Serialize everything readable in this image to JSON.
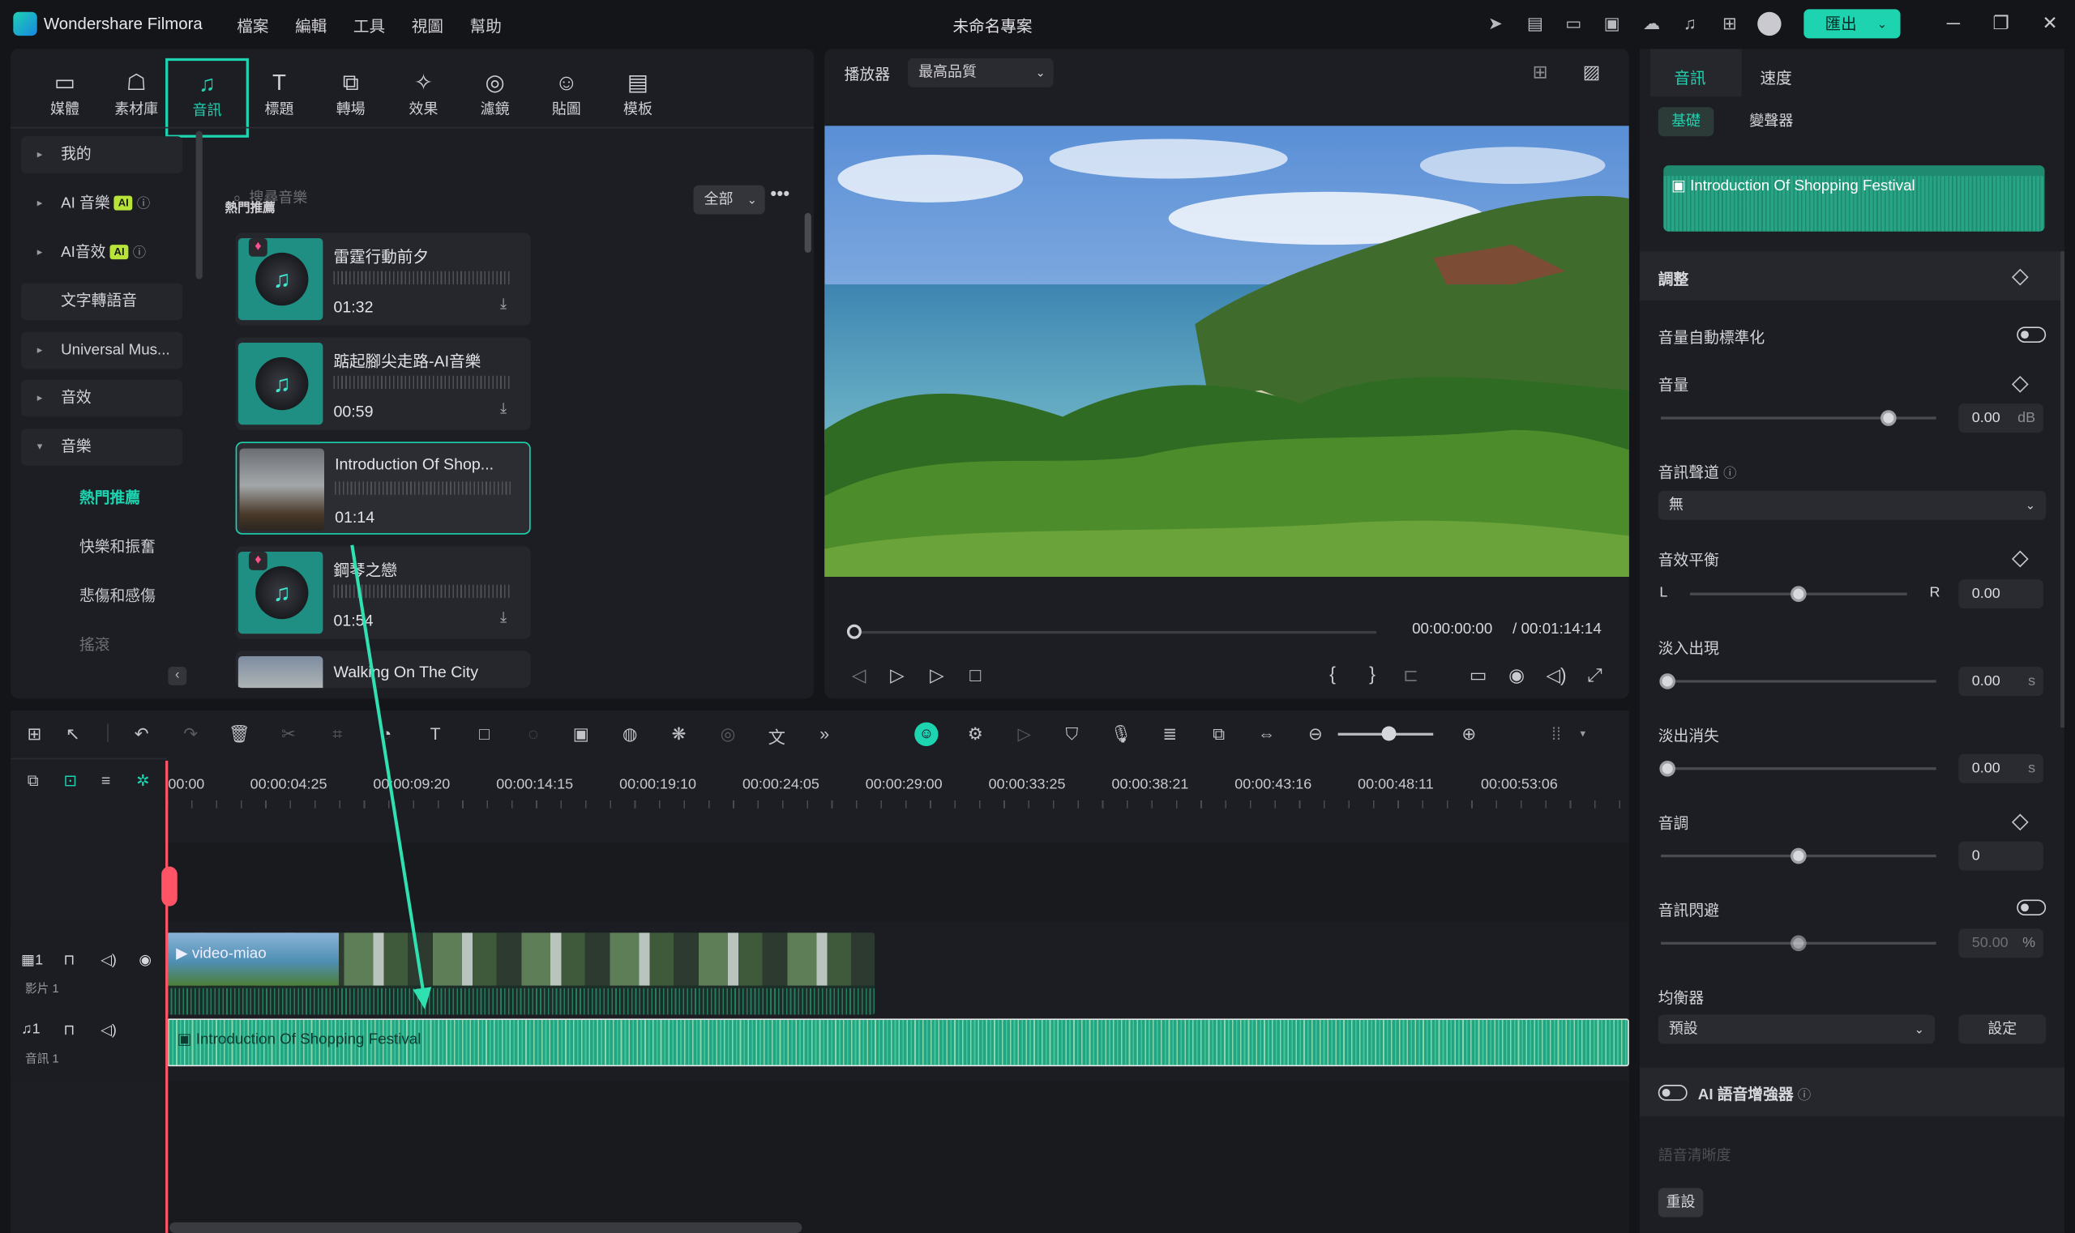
{
  "titlebar": {
    "app": "Wondershare Filmora",
    "menus": [
      "檔案",
      "編輯",
      "工具",
      "視圖",
      "幫助"
    ],
    "project": "未命名專案",
    "export": "匯出"
  },
  "media": {
    "tabs": [
      {
        "label": "媒體"
      },
      {
        "label": "素材庫"
      },
      {
        "label": "音訊"
      },
      {
        "label": "標題"
      },
      {
        "label": "轉場"
      },
      {
        "label": "效果"
      },
      {
        "label": "濾鏡"
      },
      {
        "label": "貼圖"
      },
      {
        "label": "模板"
      }
    ],
    "categories": {
      "mine": "我的",
      "ai_music": "AI 音樂",
      "ai_sfx": "AI音效",
      "tts": "文字轉語音",
      "universal": "Universal Mus...",
      "sfx": "音效",
      "music": "音樂"
    },
    "ai_badge": "AI",
    "subs": [
      "熱門推薦",
      "快樂和振奮",
      "悲傷和感傷",
      "搖滾"
    ],
    "search_placeholder": "搜尋音樂",
    "filter": "全部",
    "section": "熱門推薦",
    "items": [
      {
        "title": "雷霆行動前夕",
        "duration": "01:32"
      },
      {
        "title": "踮起腳尖走路-AI音樂",
        "duration": "00:59"
      },
      {
        "title": "Introduction Of Shop...",
        "duration": "01:14"
      },
      {
        "title": "鋼琴之戀",
        "duration": "01:54"
      },
      {
        "title": "Walking On The City",
        "duration": ""
      }
    ]
  },
  "player": {
    "label": "播放器",
    "quality": "最高品質",
    "current": "00:00:00:00",
    "total": "/  00:01:14:14"
  },
  "props": {
    "tabs": [
      "音訊",
      "速度"
    ],
    "subtabs": [
      "基礎",
      "變聲器"
    ],
    "clip": "Introduction Of Shopping Festival",
    "section": "調整",
    "auto_normalize": "音量自動標準化",
    "volume": "音量",
    "volume_val": "0.00",
    "db": "dB",
    "channel": "音訊聲道",
    "channel_val": "無",
    "balance": "音效平衡",
    "L": "L",
    "R": "R",
    "balance_val": "0.00",
    "fade_in": "淡入出現",
    "fade_in_val": "0.00",
    "fade_out": "淡出消失",
    "fade_out_val": "0.00",
    "s": "s",
    "pitch": "音調",
    "pitch_val": "0",
    "ducking": "音訊閃避",
    "ducking_val": "50.00",
    "pct": "%",
    "eq": "均衡器",
    "eq_val": "預設",
    "eq_btn": "設定",
    "ai_voice": "AI 語音增強器",
    "clarity": "語音清晰度",
    "reset": "重設"
  },
  "timeline": {
    "ticks": [
      "00:00",
      "00:00:04:25",
      "00:00:09:20",
      "00:00:14:15",
      "00:00:19:10",
      "00:00:24:05",
      "00:00:29:00",
      "00:00:33:25",
      "00:00:38:21",
      "00:00:43:16",
      "00:00:48:11",
      "00:00:53:06"
    ],
    "video_track": "影片 1",
    "audio_track": "音訊 1",
    "track_num": "1",
    "video_clip": "video-miao",
    "audio_clip": "Introduction Of Shopping Festival"
  }
}
